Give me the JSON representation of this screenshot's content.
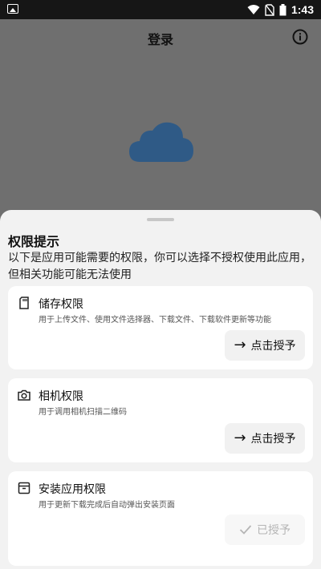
{
  "status_bar": {
    "time": "1:43"
  },
  "header": {
    "title": "登录"
  },
  "sheet": {
    "title": "权限提示",
    "description": "以下是应用可能需要的权限，你可以选择不授权使用此应用，但相关功能可能无法使用",
    "permissions": [
      {
        "icon": "sd-card-icon",
        "title": "储存权限",
        "description": "用于上传文件、使用文件选择器、下载文件、下载软件更新等功能",
        "button_label": "点击授予",
        "button_icon": "arrow-right-icon",
        "granted": false
      },
      {
        "icon": "camera-icon",
        "title": "相机权限",
        "description": "用于调用相机扫描二维码",
        "button_label": "点击授予",
        "button_icon": "arrow-right-icon",
        "granted": false
      },
      {
        "icon": "archive-icon",
        "title": "安装应用权限",
        "description": "用于更新下载完成后自动弹出安装页面",
        "button_label": "已授予",
        "button_icon": "check-icon",
        "granted": true
      }
    ]
  },
  "colors": {
    "sheet_bg": "#f2f2f2",
    "card_bg": "#ffffff",
    "dim_overlay": "#6f6f6f",
    "cloud": "#2f5a86"
  }
}
